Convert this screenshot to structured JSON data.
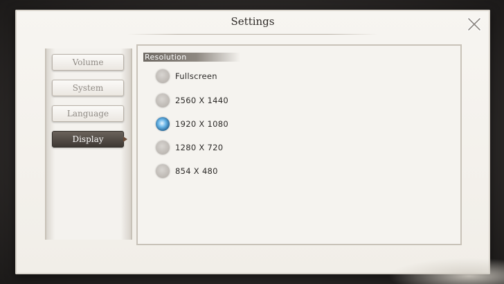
{
  "dialog": {
    "title": "Settings",
    "close_icon": "close-x-icon"
  },
  "sidebar": {
    "items": [
      {
        "label": "Volume",
        "active": false
      },
      {
        "label": "System",
        "active": false
      },
      {
        "label": "Language",
        "active": false
      },
      {
        "label": "Display",
        "active": true
      }
    ]
  },
  "panel": {
    "section_title": "Resolution",
    "options": [
      {
        "label": "Fullscreen",
        "selected": false
      },
      {
        "label": "2560 X 1440",
        "selected": false
      },
      {
        "label": "1920 X 1080",
        "selected": true
      },
      {
        "label": "1280 X 720",
        "selected": false
      },
      {
        "label": "854 X 480",
        "selected": false
      }
    ]
  },
  "colors": {
    "accent": "#4b95c9",
    "active_tab": "#4a433d",
    "panel_bg": "#f5f3ef"
  }
}
